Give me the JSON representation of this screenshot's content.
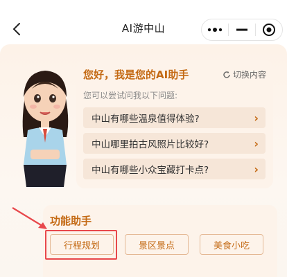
{
  "header": {
    "back_icon": "chevron-left-icon",
    "title": "AI游中山",
    "capsule": {
      "more_icon": "more-dots-icon",
      "minimize_icon": "minimize-icon",
      "close_icon": "target-close-icon"
    }
  },
  "assistant": {
    "avatar_icon": "female-guide-avatar",
    "greeting": "您好，我是您的AI助手",
    "switch_label": "切换内容",
    "switch_icon": "refresh-icon",
    "hint": "您可以尝试问我以下问题:",
    "questions": [
      {
        "text": "中山有哪些温泉值得体验?",
        "arrow": "›"
      },
      {
        "text": "中山哪里拍古风照片比较好?",
        "arrow": "›"
      },
      {
        "text": "中山有哪些小众宝藏打卡点?",
        "arrow": "›"
      }
    ]
  },
  "functions": {
    "title": "功能助手",
    "buttons": [
      "行程规划",
      "景区景点",
      "美食小吃"
    ]
  },
  "annotation": {
    "highlight_color": "#e8474b"
  },
  "colors": {
    "accent": "#c46a14",
    "card_bg": "#fdf3ea",
    "question_bg": "#f6e6d8"
  }
}
